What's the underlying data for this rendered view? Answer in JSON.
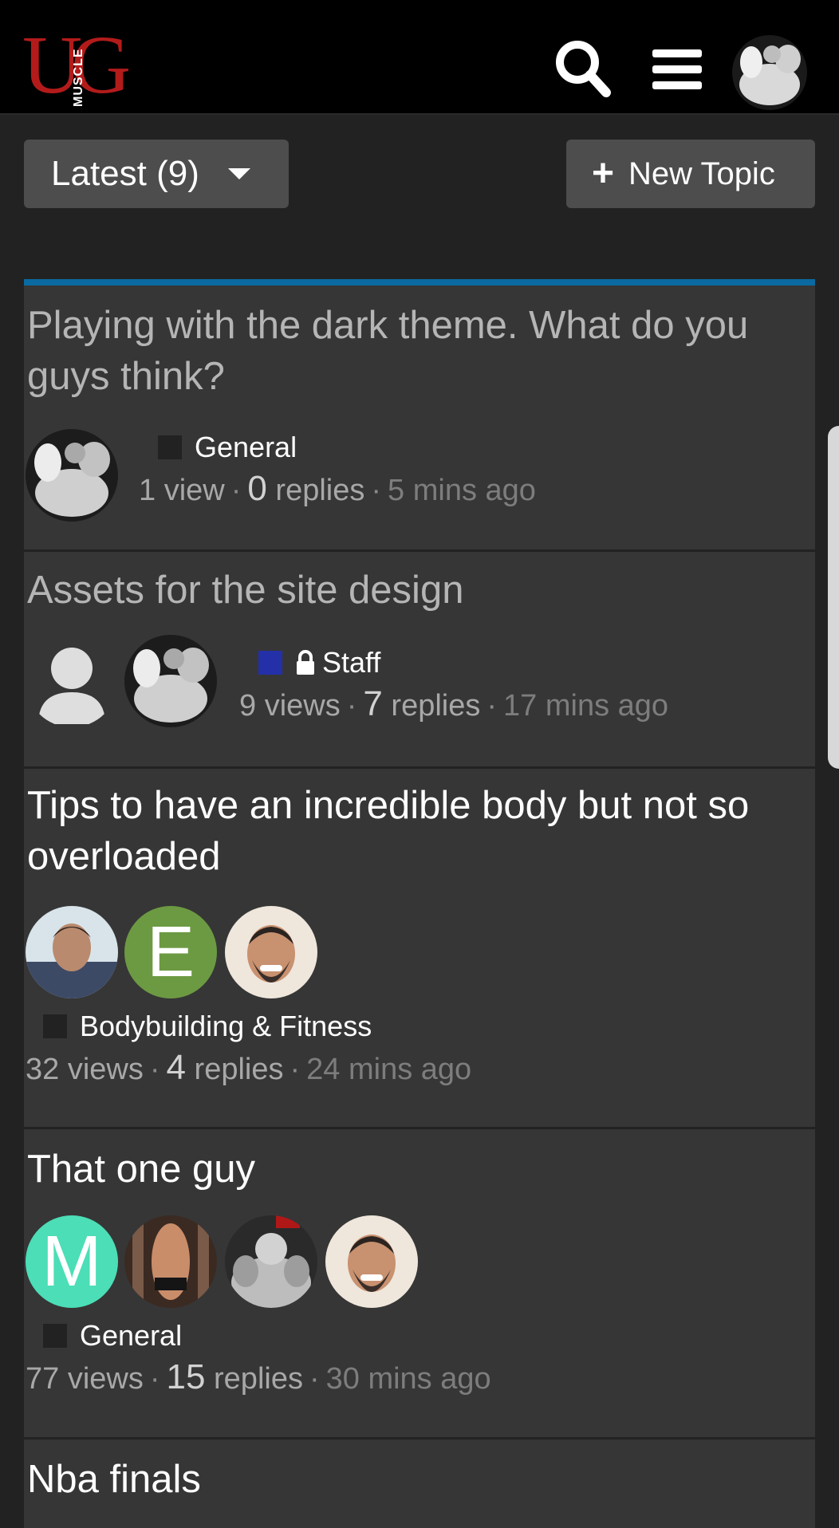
{
  "header": {
    "logo_letters": "UG",
    "logo_word": "MUSCLE",
    "icons": [
      "search-icon",
      "hamburger-menu-icon",
      "user-avatar"
    ]
  },
  "toolbar": {
    "filter_label": "Latest (9)",
    "new_topic_label": "New Topic"
  },
  "colors": {
    "accent": "#0a6aa1",
    "logo_red": "#b31b1b",
    "staff_category": "#2430a8",
    "general_category": "#222222"
  },
  "topics": [
    {
      "title": "Playing with the dark theme. What do you guys think?",
      "category": "General",
      "views": "1 view",
      "replies_num": "0",
      "replies_word": "replies",
      "ago": "5 mins ago"
    },
    {
      "title": "Assets for the site design",
      "category": "Staff",
      "views": "9 views",
      "replies_num": "7",
      "replies_word": "replies",
      "ago": "17 mins ago"
    },
    {
      "title": "Tips to have an incredible body but not so overloaded",
      "category": "Bodybuilding & Fitness",
      "views": "32 views",
      "replies_num": "4",
      "replies_word": "replies",
      "ago": "24 mins ago",
      "avatar_letter": "E"
    },
    {
      "title": "That one guy",
      "category": "General",
      "views": "77 views",
      "replies_num": "15",
      "replies_word": "replies",
      "ago": "30 mins ago",
      "avatar_letter": "M"
    },
    {
      "title": "Nba finals"
    }
  ]
}
